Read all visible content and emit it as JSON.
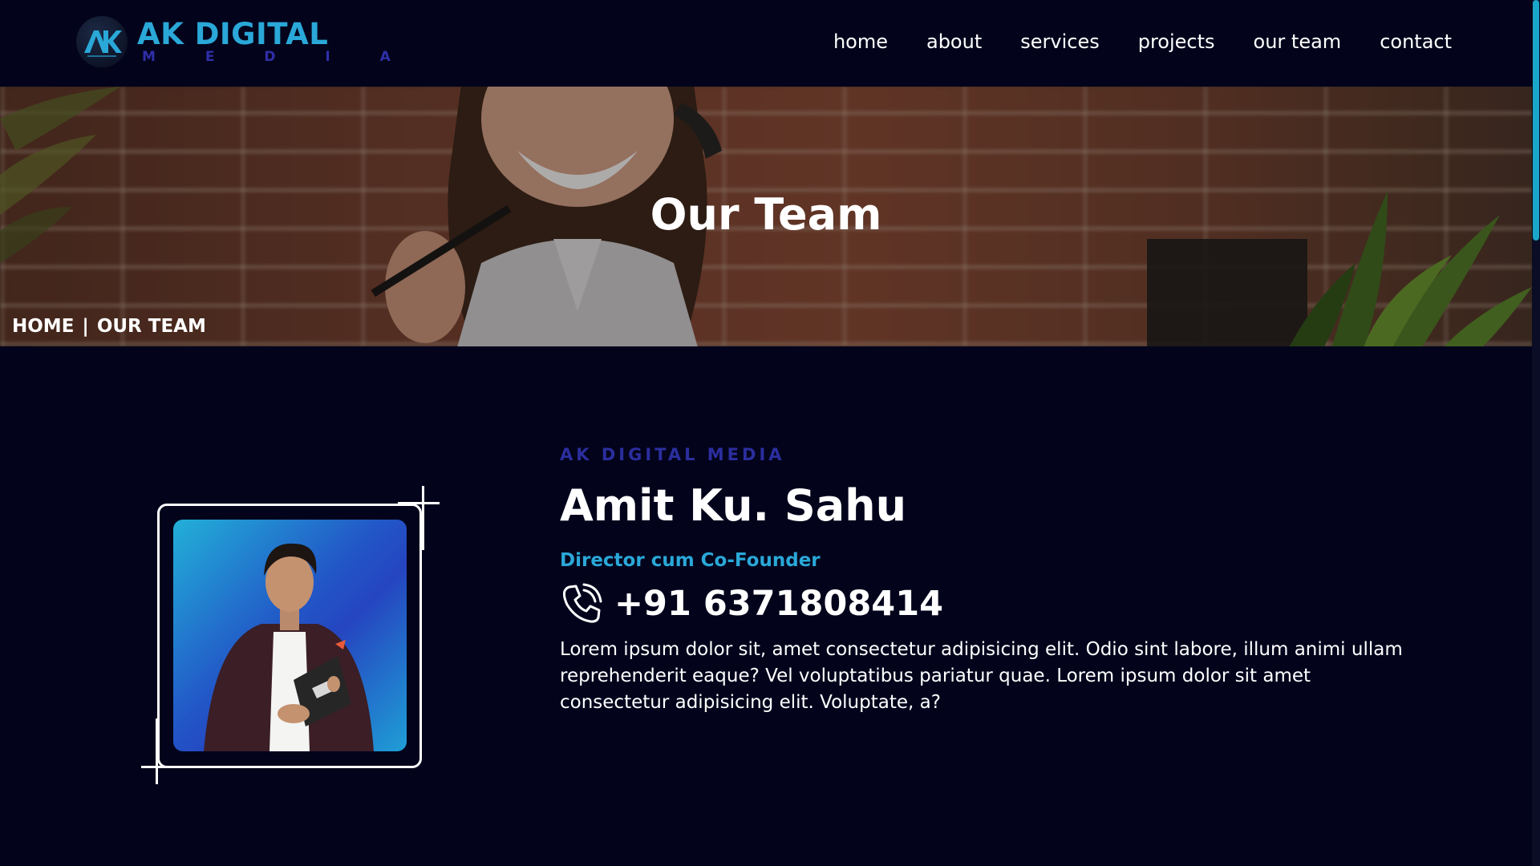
{
  "brand": {
    "name": "AK DIGITAL",
    "sub": "M E D I A",
    "colors": {
      "primary": "#2aa8d8",
      "secondary": "#2f2fa8",
      "background": "#03041c"
    }
  },
  "nav": {
    "items": [
      {
        "label": "home"
      },
      {
        "label": "about"
      },
      {
        "label": "services"
      },
      {
        "label": "projects"
      },
      {
        "label": "our team"
      },
      {
        "label": "contact"
      }
    ]
  },
  "hero": {
    "title": "Our Team",
    "breadcrumb": {
      "home": "HOME",
      "separator": "|",
      "current": "OUR TEAM"
    }
  },
  "member": {
    "company": "AK DIGITAL MEDIA",
    "name": "Amit Ku. Sahu",
    "role": "Director cum Co-Founder",
    "phone_icon": "phone-icon",
    "phone": "+91 6371808414",
    "bio": "Lorem ipsum dolor sit, amet consectetur adipisicing elit. Odio sint labore, illum animi ullam reprehenderit eaque? Vel voluptatibus pariatur quae. Lorem ipsum dolor sit amet consectetur adipisicing elit. Voluptate, a?"
  }
}
